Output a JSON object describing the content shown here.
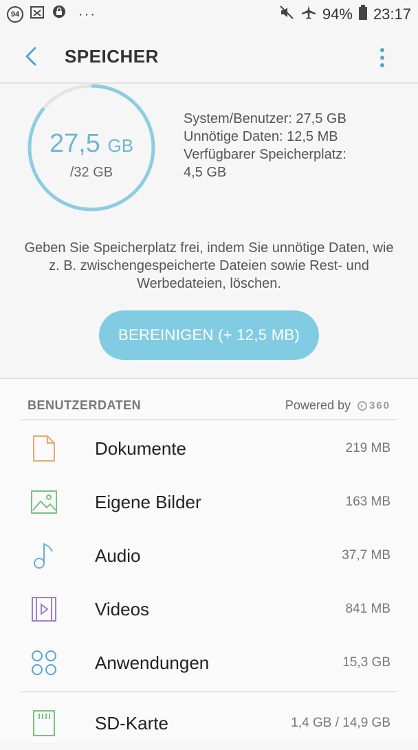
{
  "statusbar": {
    "badge": "94",
    "dots": "···",
    "battery": "94%",
    "time": "23:17"
  },
  "appbar": {
    "title": "SPEICHER"
  },
  "storage": {
    "used_value": "27,5",
    "used_unit": "GB",
    "total": "/32 GB",
    "used_fraction": 0.86,
    "info": [
      "System/Benutzer: 27,5 GB",
      "Unnötige Daten: 12,5 MB",
      "Verfügbarer Speicherplatz:",
      "4,5 GB"
    ]
  },
  "description": "Geben Sie Speicherplatz frei, indem Sie unnötige Daten, wie z. B. zwischengespeicherte Dateien sowie Rest- und Werbedateien, löschen.",
  "clean_button": "BEREINIGEN (+ 12,5 MB)",
  "user_data": {
    "title": "BENUTZERDATEN",
    "powered_by": "Powered by",
    "logo_text": "360",
    "items": [
      {
        "label": "Dokumente",
        "size": "219 MB",
        "icon": "document-icon",
        "color": "#e8a86b"
      },
      {
        "label": "Eigene Bilder",
        "size": "163 MB",
        "icon": "image-icon",
        "color": "#79c27f"
      },
      {
        "label": "Audio",
        "size": "37,7 MB",
        "icon": "music-note-icon",
        "color": "#6aaed6"
      },
      {
        "label": "Videos",
        "size": "841 MB",
        "icon": "video-icon",
        "color": "#9b82c9"
      },
      {
        "label": "Anwendungen",
        "size": "15,3 GB",
        "icon": "apps-icon",
        "color": "#5aa4d4"
      }
    ],
    "sd_card": {
      "label": "SD-Karte",
      "size": "1,4 GB / 14,9 GB",
      "icon": "sd-card-icon",
      "color": "#79c27f"
    }
  },
  "colors": {
    "accent": "#6fb7cf",
    "button": "#82cce3"
  }
}
